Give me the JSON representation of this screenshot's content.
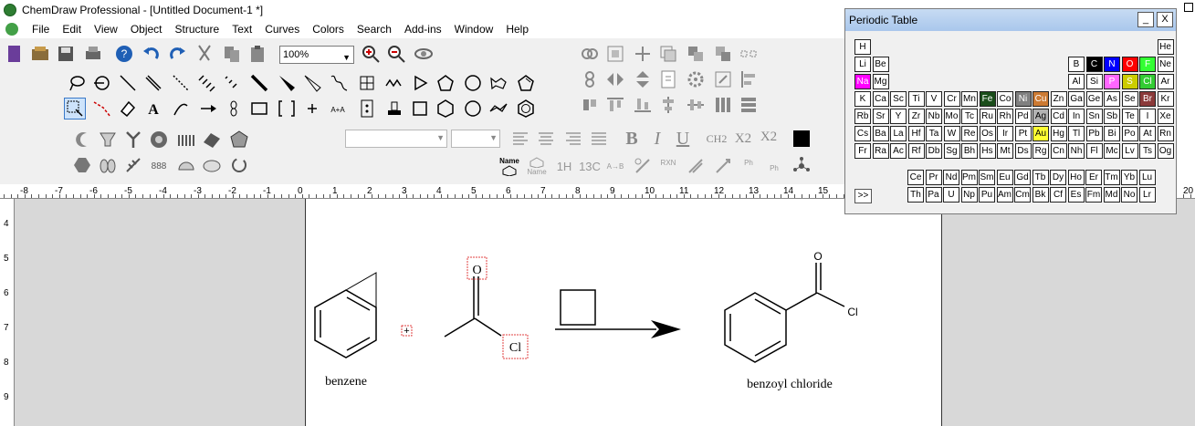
{
  "window": {
    "title": "ChemDraw Professional - [Untitled Document-1 *]"
  },
  "menu": [
    "File",
    "Edit",
    "View",
    "Object",
    "Structure",
    "Text",
    "Curves",
    "Colors",
    "Search",
    "Add-ins",
    "Window",
    "Help"
  ],
  "toolbar": {
    "zoom_value": "100%",
    "icons_row1": [
      "new-document-icon",
      "open-icon",
      "save-icon",
      "print-icon",
      "help-icon",
      "undo-icon",
      "redo-icon",
      "cut-icon",
      "copy-icon",
      "paste-icon"
    ],
    "zoom_in_icon": "zoom-in-icon",
    "zoom_out_icon": "zoom-out-icon",
    "rotate3d_icon": "rotate-3d-icon",
    "format_labels": {
      "subscript_ch2": "CH2",
      "x2_sub": "X2",
      "x2_sup": "X2"
    },
    "text_format": {
      "bold": "B",
      "italic": "I",
      "underline": "U"
    },
    "misc_labels": {
      "name_struct": "Name",
      "struct_name": "Name",
      "h_nmr": "1H",
      "c_nmr": "13C",
      "rxn": "RXN",
      "ph1": "Ph",
      "ph2": "Ph",
      "ab": "A→B",
      "text_tool": "A",
      "a_to_a": "A+A"
    }
  },
  "ruler": {
    "h_labels": [
      "-8",
      "-7",
      "-6",
      "-5",
      "-4",
      "-3",
      "-2",
      "-1",
      "0",
      "1",
      "2",
      "3",
      "4",
      "5",
      "6",
      "7",
      "8",
      "9",
      "10",
      "11",
      "12",
      "13",
      "14",
      "15",
      "20"
    ],
    "v_labels": [
      "4",
      "5",
      "6",
      "7",
      "8",
      "9"
    ]
  },
  "document": {
    "benzene_label": "benzene",
    "product_label": "benzoyl chloride",
    "reactant_o": "O",
    "reactant_cl": "Cl",
    "product_o": "O",
    "product_cl": "Cl",
    "plus": "+"
  },
  "periodic_table": {
    "title": "Periodic Table",
    "minimize": "_",
    "close": "X",
    "more": ">>",
    "main_rows": [
      [
        "H",
        "",
        "",
        "",
        "",
        "",
        "",
        "",
        "",
        "",
        "",
        "",
        "",
        "",
        "",
        "",
        "",
        "He"
      ],
      [
        "Li",
        "Be",
        "",
        "",
        "",
        "",
        "",
        "",
        "",
        "",
        "",
        "",
        "B",
        "C",
        "N",
        "O",
        "F",
        "Ne"
      ],
      [
        "Na",
        "Mg",
        "",
        "",
        "",
        "",
        "",
        "",
        "",
        "",
        "",
        "",
        "Al",
        "Si",
        "P",
        "S",
        "Cl",
        "Ar"
      ],
      [
        "K",
        "Ca",
        "Sc",
        "Ti",
        "V",
        "Cr",
        "Mn",
        "Fe",
        "Co",
        "Ni",
        "Cu",
        "Zn",
        "Ga",
        "Ge",
        "As",
        "Se",
        "Br",
        "Kr"
      ],
      [
        "Rb",
        "Sr",
        "Y",
        "Zr",
        "Nb",
        "Mo",
        "Tc",
        "Ru",
        "Rh",
        "Pd",
        "Ag",
        "Cd",
        "In",
        "Sn",
        "Sb",
        "Te",
        "I",
        "Xe"
      ],
      [
        "Cs",
        "Ba",
        "La",
        "Hf",
        "Ta",
        "W",
        "Re",
        "Os",
        "Ir",
        "Pt",
        "Au",
        "Hg",
        "Tl",
        "Pb",
        "Bi",
        "Po",
        "At",
        "Rn"
      ],
      [
        "Fr",
        "Ra",
        "Ac",
        "Rf",
        "Db",
        "Sg",
        "Bh",
        "Hs",
        "Mt",
        "Ds",
        "Rg",
        "Cn",
        "Nh",
        "Fl",
        "Mc",
        "Lv",
        "Ts",
        "Og"
      ]
    ],
    "f_rows": [
      [
        "Ce",
        "Pr",
        "Nd",
        "Pm",
        "Sm",
        "Eu",
        "Gd",
        "Tb",
        "Dy",
        "Ho",
        "Er",
        "Tm",
        "Yb",
        "Lu"
      ],
      [
        "Th",
        "Pa",
        "U",
        "Np",
        "Pu",
        "Am",
        "Cm",
        "Bk",
        "Cf",
        "Es",
        "Fm",
        "Md",
        "No",
        "Lr"
      ]
    ],
    "colored": {
      "C": {
        "bg": "#000000",
        "fg": "#ffffff"
      },
      "N": {
        "bg": "#0000ff",
        "fg": "#ffffff"
      },
      "O": {
        "bg": "#ff0000",
        "fg": "#ffffff"
      },
      "F": {
        "bg": "#33ff33",
        "fg": "#ffffff"
      },
      "Na": {
        "bg": "#ff00ff",
        "fg": "#ffffff"
      },
      "P": {
        "bg": "#ff66ff",
        "fg": "#ffffff"
      },
      "S": {
        "bg": "#cccc00",
        "fg": "#ffffff"
      },
      "Cl": {
        "bg": "#33cc33",
        "fg": "#ffffff"
      },
      "Fe": {
        "bg": "#1a4d1a",
        "fg": "#ffffff"
      },
      "Ni": {
        "bg": "#808080",
        "fg": "#ffffff"
      },
      "Cu": {
        "bg": "#cc7a33",
        "fg": "#ffffff"
      },
      "Br": {
        "bg": "#8b3a3a",
        "fg": "#ffffff"
      },
      "Ag": {
        "bg": "#b3b3b3",
        "fg": "#000000"
      },
      "Au": {
        "bg": "#ffff33",
        "fg": "#000000"
      }
    }
  }
}
